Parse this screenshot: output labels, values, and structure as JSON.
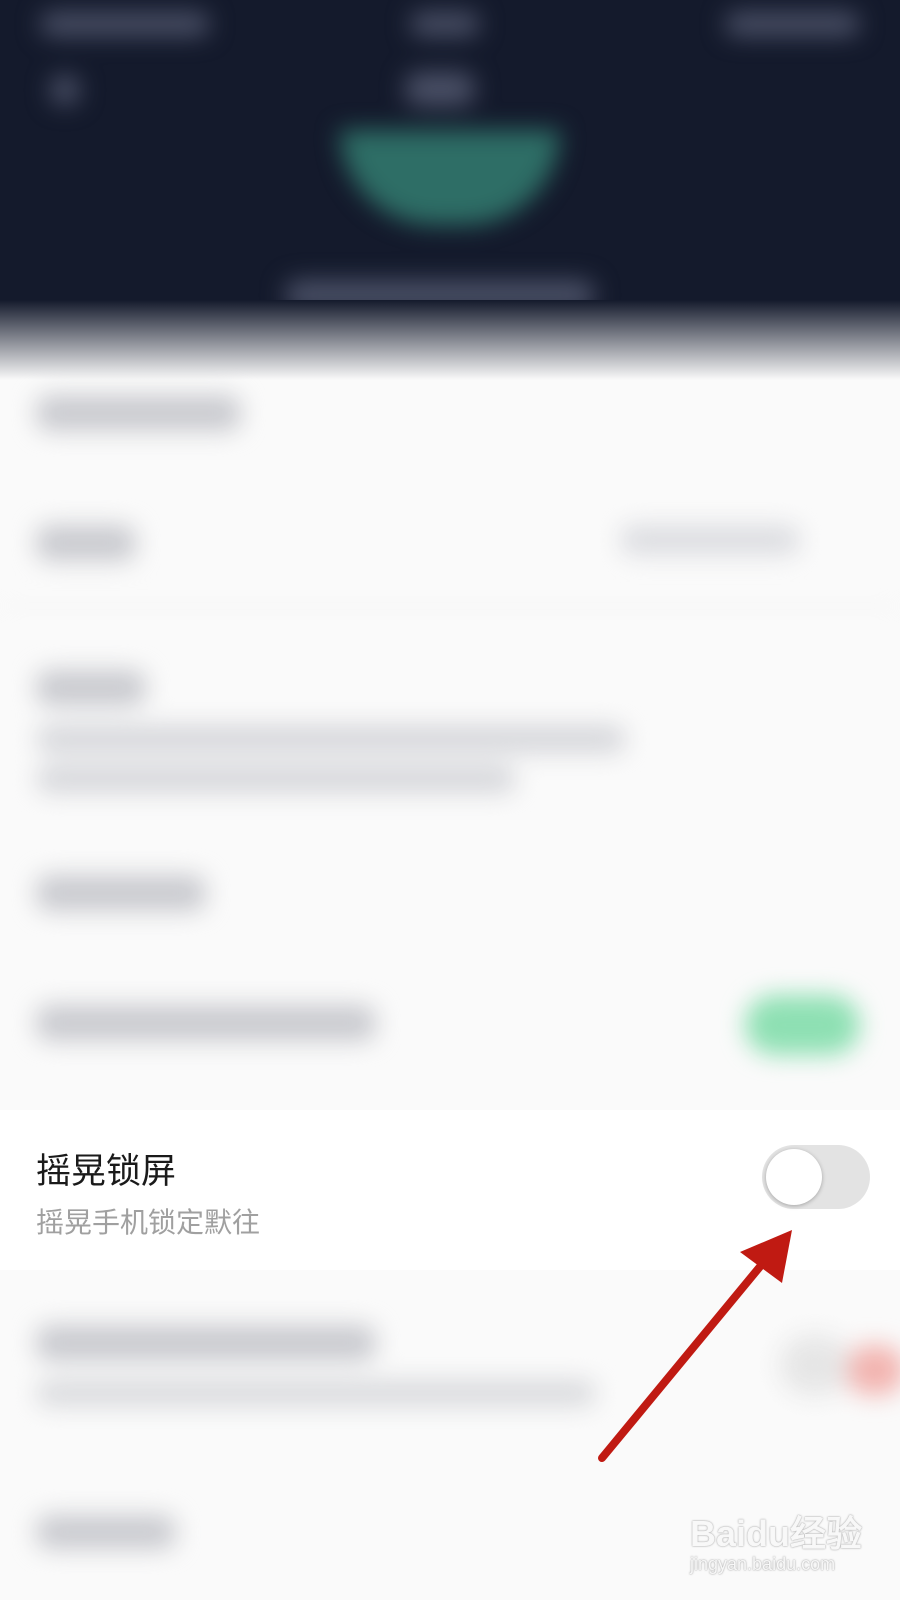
{
  "setting": {
    "title": "摇晃锁屏",
    "subtitle": "摇晃手机锁定默往",
    "toggle_on": false
  },
  "annotation": {
    "arrow_color": "#c01a12",
    "arrow_icon": "red-arrow-icon"
  },
  "watermark": {
    "brand": "Baidu经验",
    "url": "jingyan.baidu.com"
  },
  "colors": {
    "header_bg": "#141a2c",
    "page_bg": "#fafafa",
    "toggle_off_track": "#e3e3e3"
  }
}
